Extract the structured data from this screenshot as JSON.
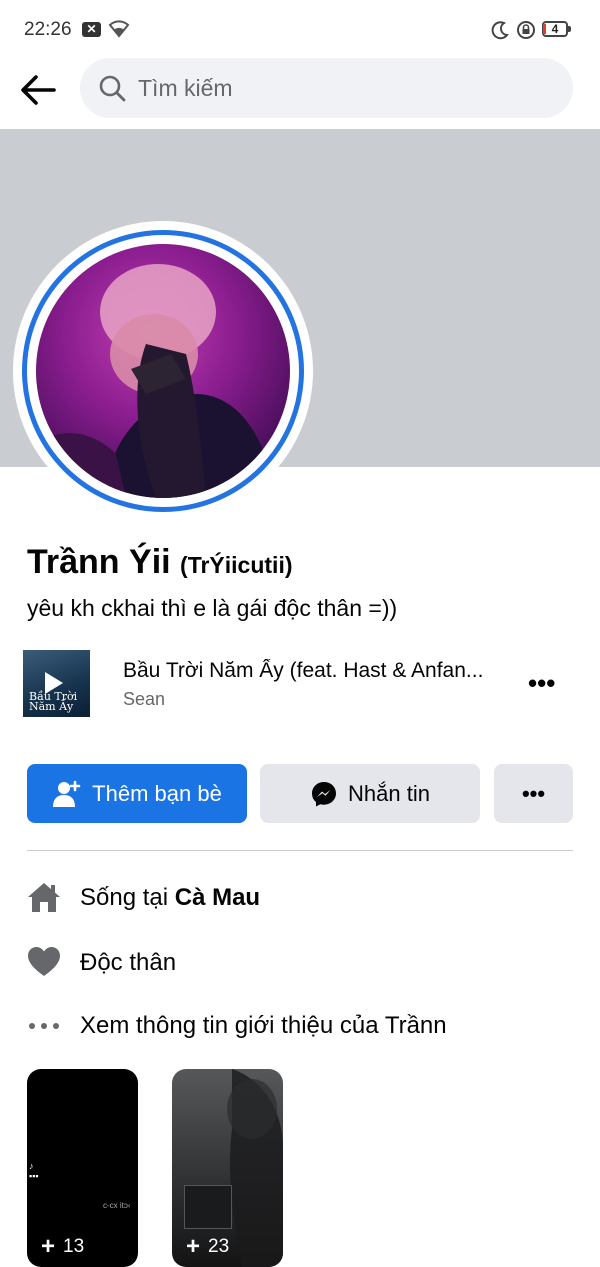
{
  "status_bar": {
    "time": "22:26",
    "battery": "4"
  },
  "search": {
    "placeholder": "Tìm kiếm"
  },
  "profile": {
    "name": "Trầnn Ýii",
    "alternate_name": "(TrÝiicutii)",
    "bio": "yêu kh ckhai thì e là gái độc thân =))"
  },
  "music": {
    "title": "Bầu Trời Năm Ấy (feat. Hast & Anfan...",
    "artist": "Sean",
    "art_text_line1": "Bầu Trời",
    "art_text_line2": "Năm Ấy",
    "more": "•••"
  },
  "actions": {
    "add_friend": "Thêm bạn bè",
    "message": "Nhắn tin",
    "more": "•••"
  },
  "intro": {
    "lives_prefix": "Sống tại ",
    "lives_place": "Cà Mau",
    "relationship": "Độc thân",
    "see_about": "Xem thông tin giới thiệu của Trầnn"
  },
  "stories": [
    {
      "count": "13",
      "caption": "c-cx itɔ‹"
    },
    {
      "count": "23"
    }
  ],
  "colors": {
    "primary_blue": "#1b74e4",
    "secondary_button": "#e4e6eb",
    "cover": "#c9ccd1",
    "search_bg": "#f0f2f5"
  }
}
